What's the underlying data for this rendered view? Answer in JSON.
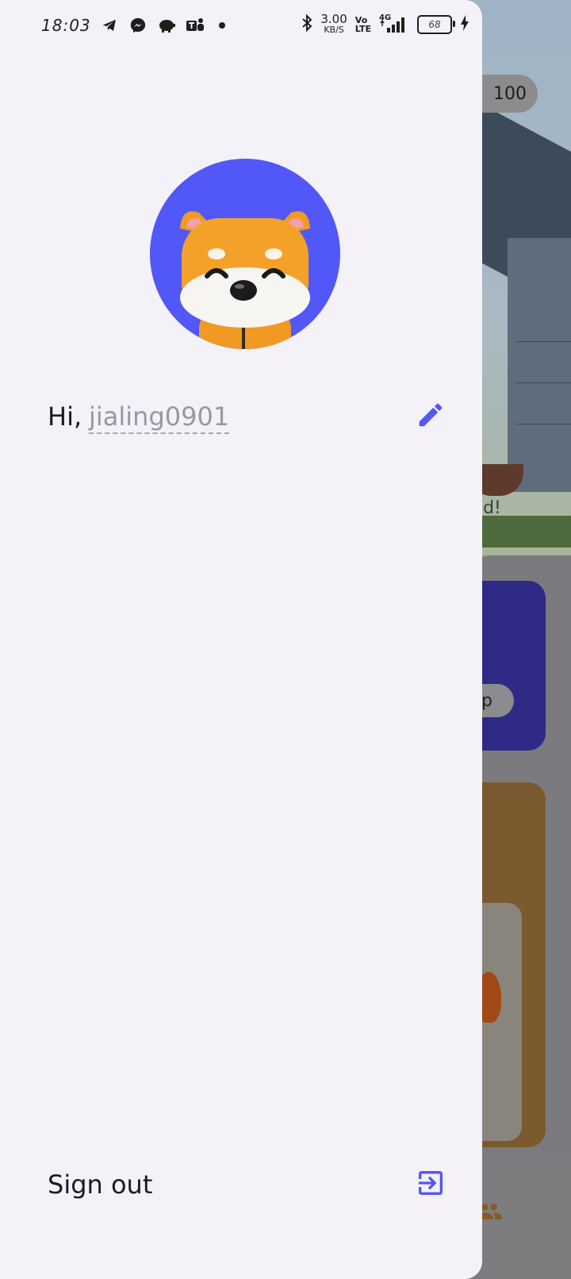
{
  "status_bar": {
    "time": "18:03",
    "net_speed_value": "3.00",
    "net_speed_unit": "KB/S",
    "volte_top": "Vo",
    "volte_bottom": "LTE",
    "signal_label": "4G",
    "battery_level": "68",
    "icons": [
      "telegram-icon",
      "messenger-icon",
      "piggy-bank-icon",
      "teams-icon",
      "notification-dot",
      "bluetooth-icon",
      "signal-icon",
      "battery-icon",
      "charging-icon"
    ]
  },
  "drawer": {
    "greeting_prefix": "Hi,",
    "username": "jialing0901",
    "edit_icon": "pencil-icon",
    "sign_out_label": "Sign out",
    "sign_out_icon": "exit-icon",
    "accent_color": "#5257f7",
    "avatar": "shiba-inu-avatar"
  },
  "background_app": {
    "coin_count": "100",
    "feed_text": "eed!",
    "button_fragment": "p"
  }
}
